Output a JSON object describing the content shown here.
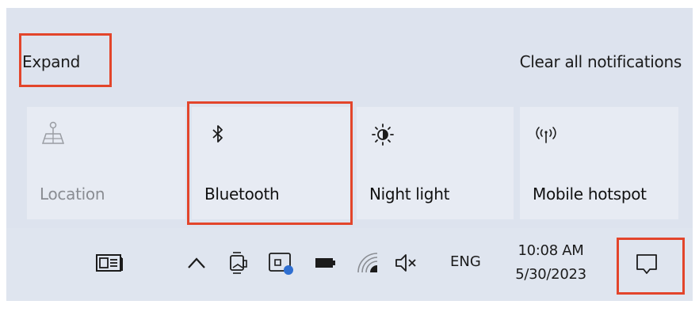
{
  "action_center": {
    "expand_label": "Expand",
    "clear_label": "Clear all notifications",
    "tiles": [
      {
        "label": "Location",
        "icon": "location-icon",
        "enabled": false
      },
      {
        "label": "Bluetooth",
        "icon": "bluetooth-icon",
        "enabled": true
      },
      {
        "label": "Night light",
        "icon": "night-light-icon",
        "enabled": true
      },
      {
        "label": "Mobile hotspot",
        "icon": "mobile-hotspot-icon",
        "enabled": true
      }
    ]
  },
  "taskbar": {
    "icons": [
      "news-and-interests-icon",
      "show-hidden-icons-chevron",
      "meet-now-icon",
      "screen-clip-icon",
      "battery-icon",
      "wifi-icon",
      "volume-muted-icon"
    ],
    "language": "ENG",
    "time": "10:08 AM",
    "date": "5/30/2023",
    "notifications_icon": "action-center-icon"
  },
  "highlight_color": "#e3452b"
}
